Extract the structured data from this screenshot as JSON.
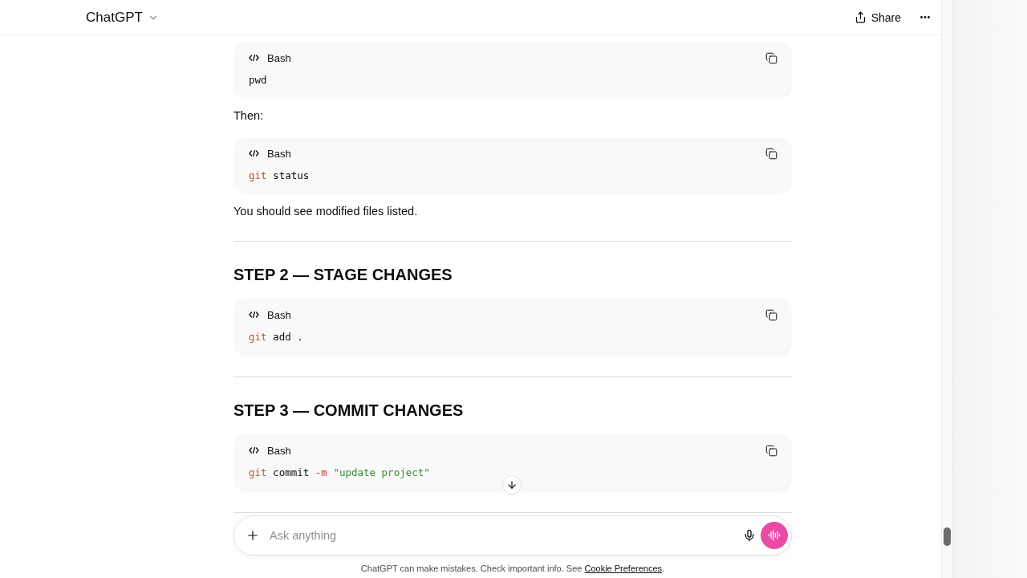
{
  "header": {
    "title": "ChatGPT",
    "share": "Share"
  },
  "content": [
    {
      "kind": "code",
      "language": "Bash",
      "tokens": [
        {
          "kind": "plain",
          "text": "pwd"
        }
      ]
    },
    {
      "kind": "paragraph",
      "text": "Then:"
    },
    {
      "kind": "code",
      "language": "Bash",
      "tokens": [
        {
          "kind": "command",
          "text": "git"
        },
        {
          "kind": "plain",
          "text": " status"
        }
      ]
    },
    {
      "kind": "paragraph",
      "text": "You should see modified files listed."
    },
    {
      "kind": "divider"
    },
    {
      "kind": "heading",
      "text": "STEP 2 — STAGE CHANGES"
    },
    {
      "kind": "code",
      "language": "Bash",
      "tokens": [
        {
          "kind": "command",
          "text": "git"
        },
        {
          "kind": "plain",
          "text": " add ."
        }
      ]
    },
    {
      "kind": "divider"
    },
    {
      "kind": "heading",
      "text": "STEP 3 — COMMIT CHANGES"
    },
    {
      "kind": "code",
      "language": "Bash",
      "tokens": [
        {
          "kind": "command",
          "text": "git"
        },
        {
          "kind": "plain",
          "text": " commit "
        },
        {
          "kind": "flag",
          "text": "-m"
        },
        {
          "kind": "string",
          "text": " \"update project\""
        }
      ]
    },
    {
      "kind": "divider"
    }
  ],
  "composer": {
    "placeholder": "Ask anything"
  },
  "disclaimer": {
    "text": "ChatGPT can make mistakes. Check important info. See ",
    "link": "Cookie Preferences",
    "end": "."
  }
}
